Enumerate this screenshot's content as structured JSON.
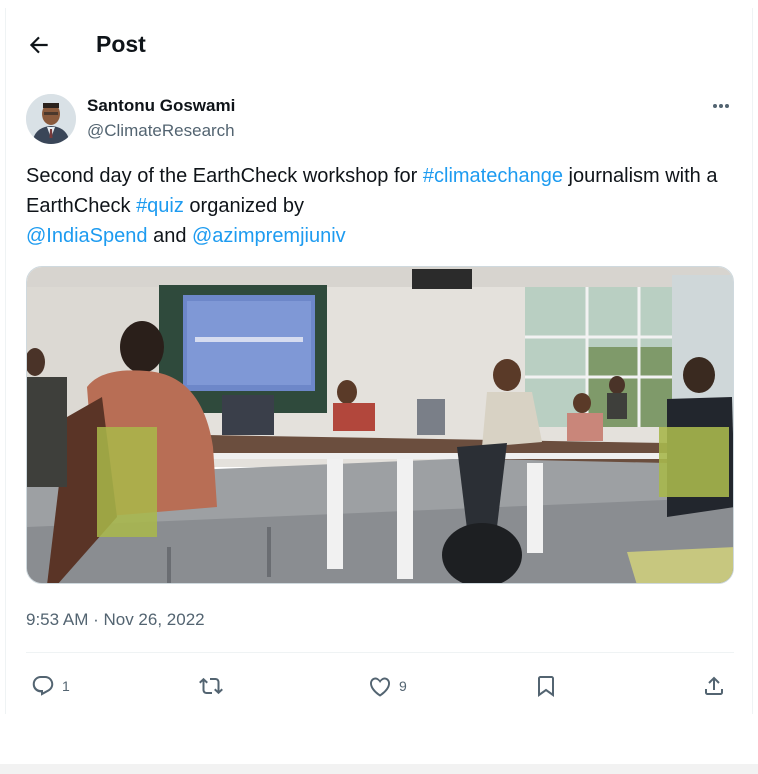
{
  "header": {
    "title": "Post"
  },
  "tweet": {
    "author": {
      "name": "Santonu Goswami",
      "handle": "@ClimateResearch"
    },
    "text_parts": {
      "p1": "Second day of the EarthCheck workshop for ",
      "tag1": "#climatechange",
      "p2": " journalism with a EarthCheck ",
      "tag2": "#quiz",
      "p3": " organized by ",
      "mention1": "@IndiaSpend",
      "p4": " and ",
      "mention2": "@azimpremjiuniv"
    },
    "timestamp": "9:53 AM · Nov 26, 2022",
    "stats": {
      "replies": "1",
      "likes": "9"
    }
  },
  "colors": {
    "link": "#1d9bf0",
    "secondary": "#536471",
    "text": "#0f1419",
    "border": "#eff3f4"
  },
  "icons": [
    "back-arrow-icon",
    "more-icon",
    "reply-icon",
    "retweet-icon",
    "like-icon",
    "bookmark-icon",
    "share-icon"
  ]
}
